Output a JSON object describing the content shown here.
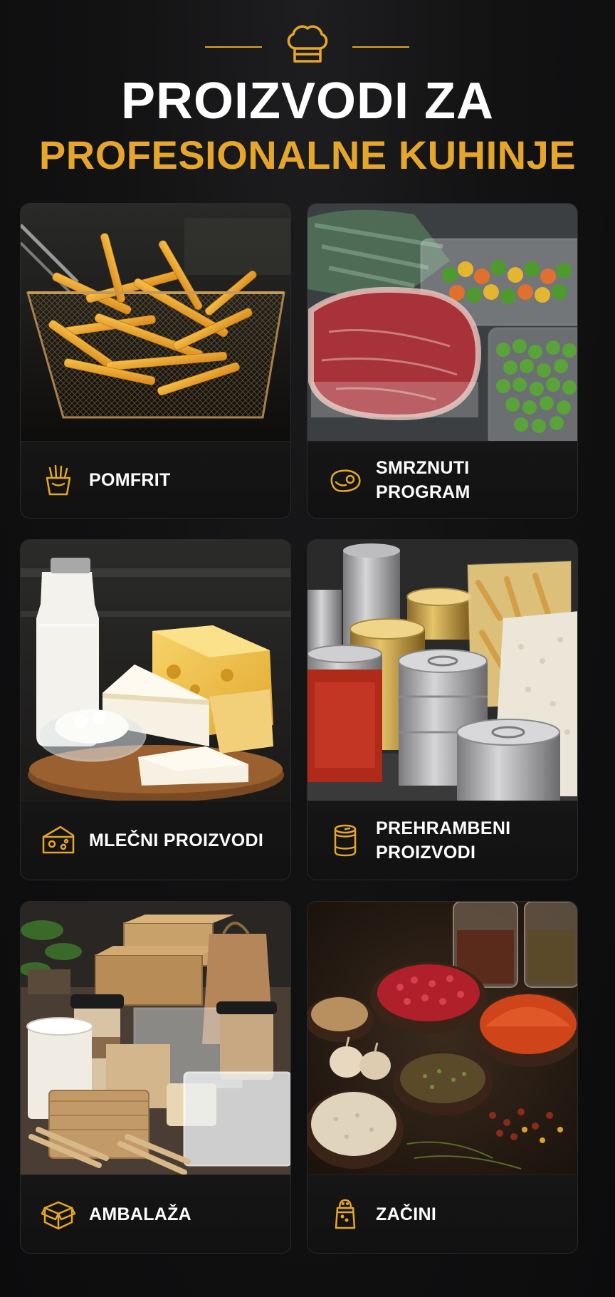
{
  "header": {
    "title_line1": "PROIZVODI ZA",
    "title_line2": "PROFESIONALNE KUHINJE",
    "icon": "chef-hat-icon"
  },
  "colors": {
    "background": "#0f0f10",
    "accent": "#e5a62b",
    "text": "#ffffff",
    "card": "#141415"
  },
  "categories": [
    {
      "label": "POMFRIT",
      "icon": "french-fries-icon"
    },
    {
      "label": "SMRZNUTI PROGRAM",
      "icon": "steak-icon"
    },
    {
      "label": "MLEČNI PROIZVODI",
      "icon": "cheese-icon"
    },
    {
      "label": "PREHRAMBENI\nPROIZVODI",
      "icon": "can-icon"
    },
    {
      "label": "AMBALAŽA",
      "icon": "box-icon"
    },
    {
      "label": "ZAČINI",
      "icon": "salt-shaker-icon"
    }
  ]
}
